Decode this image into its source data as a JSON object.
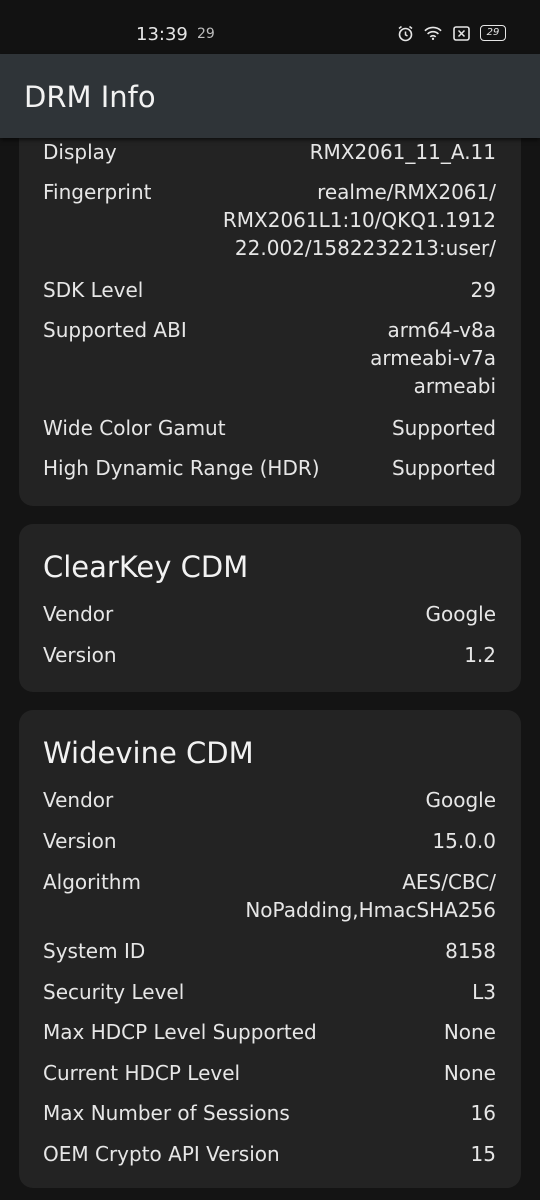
{
  "status_bar": {
    "time": "13:39",
    "notification": "29",
    "battery": "29",
    "icons": [
      "alarm-icon",
      "wifi-icon",
      "sim-icon",
      "battery-icon"
    ]
  },
  "app_bar": {
    "title": "DRM Info"
  },
  "device_card": {
    "rows": [
      {
        "label": "Display",
        "value": "RMX2061_11_A.11"
      },
      {
        "label": "Fingerprint",
        "value": "realme/RMX2061/\nRMX2061L1:10/QKQ1.1912\n22.002/1582232213:user/"
      },
      {
        "label": "SDK Level",
        "value": "29"
      },
      {
        "label": "Supported ABI",
        "value": "arm64-v8a\narmeabi-v7a\narmeabi"
      },
      {
        "label": "Wide Color Gamut",
        "value": "Supported"
      },
      {
        "label": "High Dynamic Range (HDR)",
        "value": "Supported"
      }
    ]
  },
  "clearkey_card": {
    "title": "ClearKey CDM",
    "rows": [
      {
        "label": "Vendor",
        "value": "Google"
      },
      {
        "label": "Version",
        "value": "1.2"
      }
    ]
  },
  "widevine_card": {
    "title": "Widevine CDM",
    "rows": [
      {
        "label": "Vendor",
        "value": "Google"
      },
      {
        "label": "Version",
        "value": "15.0.0"
      },
      {
        "label": "Algorithm",
        "value": "AES/CBC/\nNoPadding,HmacSHA256"
      },
      {
        "label": "System ID",
        "value": "8158"
      },
      {
        "label": "Security Level",
        "value": "L3"
      },
      {
        "label": "Max HDCP Level Supported",
        "value": "None"
      },
      {
        "label": "Current HDCP Level",
        "value": "None"
      },
      {
        "label": "Max Number of Sessions",
        "value": "16"
      },
      {
        "label": "OEM Crypto API Version",
        "value": "15"
      }
    ]
  }
}
